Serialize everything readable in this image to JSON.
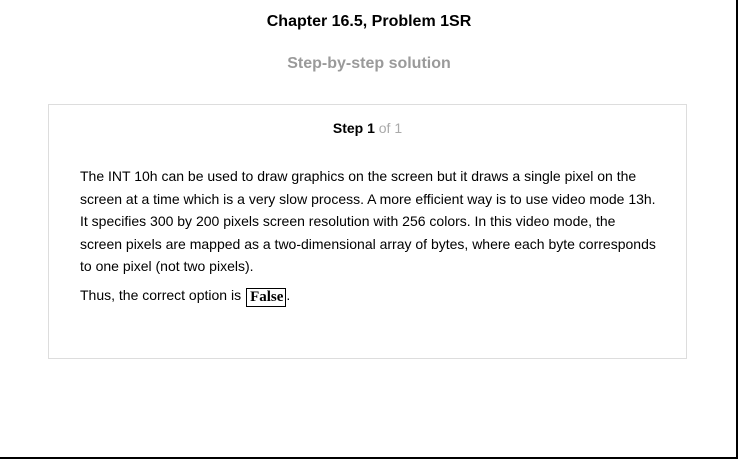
{
  "header": {
    "chapter_title": "Chapter 16.5, Problem 1SR",
    "subtitle": "Step-by-step solution"
  },
  "step": {
    "label": "Step 1",
    "count": "of 1",
    "paragraph": "The INT 10h can be used to draw graphics on the screen but it draws a single pixel on the screen at a time which is a very slow process. A more efficient way is to use video mode 13h. It specifies 300 by 200 pixels screen resolution with 256 colors. In this video mode, the screen pixels are mapped as a two-dimensional array of bytes, where each byte corresponds to one pixel (not two pixels).",
    "conclusion_prefix": "Thus, the correct option is",
    "answer": "False",
    "conclusion_suffix": "."
  }
}
